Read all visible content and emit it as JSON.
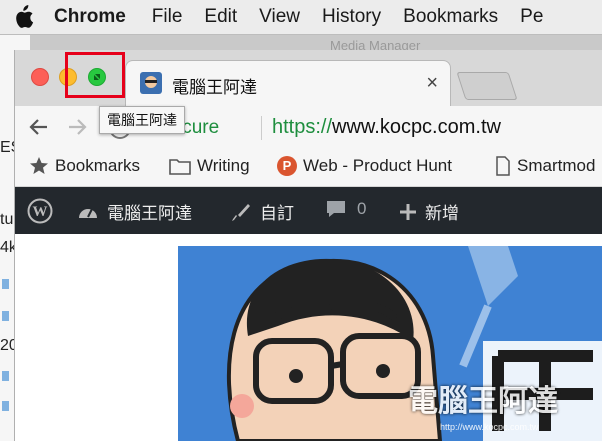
{
  "menubar": {
    "app": "Chrome",
    "items": [
      "File",
      "Edit",
      "View",
      "History",
      "Bookmarks",
      "Pe"
    ]
  },
  "background_window": {
    "title": "Media Manager",
    "fragments": [
      "ES",
      "tu",
      "4k",
      "20"
    ]
  },
  "tab": {
    "title": "電腦王阿達",
    "close_glyph": "×"
  },
  "tooltip": "電腦王阿達",
  "toolbar": {
    "secure_label": "Secure",
    "url_protocol": "https://",
    "url_host": "www.kocpc.com.tw"
  },
  "bookmarks": [
    {
      "label": "Bookmarks",
      "icon": "star-icon"
    },
    {
      "label": "Writing",
      "icon": "folder-icon"
    },
    {
      "label": "Web - Product Hunt",
      "icon": "producthunt-icon",
      "icon_text": "P"
    },
    {
      "label": "Smartmod",
      "icon": "page-icon"
    }
  ],
  "wpbar": {
    "site": "電腦王阿達",
    "customize": "自訂",
    "comments": "0",
    "new": "新增"
  },
  "content": {
    "watermark": "電腦王阿達",
    "watermark_url": "http://www.kocpc.com.tw"
  },
  "colors": {
    "highlight": "#e6001a",
    "wp_bar": "#23282d",
    "secure_green": "#1e8e3e"
  }
}
